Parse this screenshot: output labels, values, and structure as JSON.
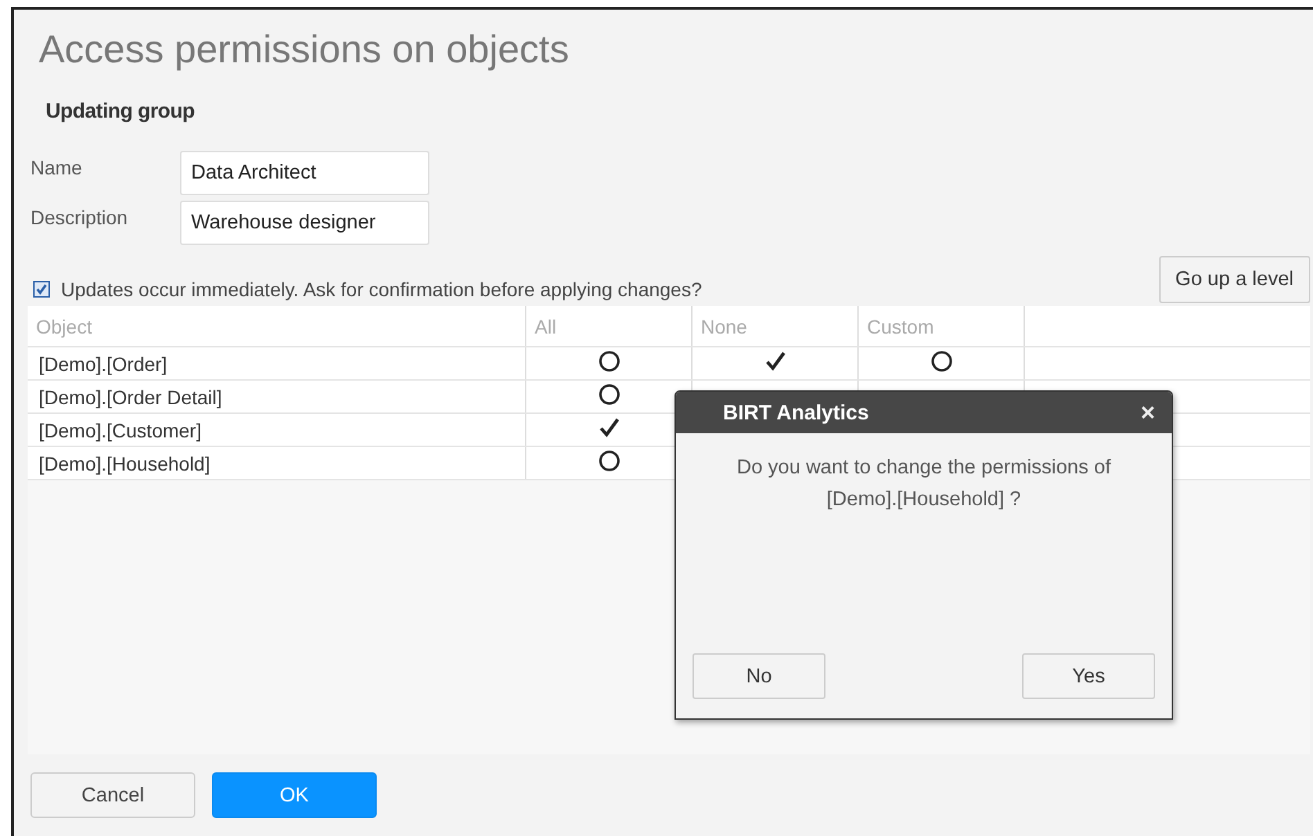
{
  "page": {
    "title": "Access permissions on objects",
    "subtitle": "Updating group"
  },
  "fields": [
    {
      "label": "Name",
      "value": "Data Architect"
    },
    {
      "label": "Description",
      "value": "Warehouse designer"
    }
  ],
  "confirm_option": {
    "label": "Updates occur immediately. Ask for confirmation before applying changes?",
    "checked": true
  },
  "go_up_button": "Go up a level",
  "table": {
    "columns": [
      "Object",
      "All",
      "None",
      "Custom"
    ],
    "rows": [
      {
        "object": "[Demo].[Order]",
        "cells": [
          {
            "checked": false
          },
          {
            "checked": true
          },
          {
            "checked": false
          }
        ]
      },
      {
        "object": "[Demo].[Order Detail]",
        "cells": [
          {
            "checked": false
          }
        ]
      },
      {
        "object": "[Demo].[Customer]",
        "cells": [
          {
            "checked": true
          }
        ]
      },
      {
        "object": "[Demo].[Household]",
        "cells": [
          {
            "checked": false
          }
        ]
      }
    ]
  },
  "buttons": [
    {
      "label": "Cancel",
      "kind": "secondary"
    },
    {
      "label": "OK",
      "kind": "primary"
    }
  ],
  "dialog": {
    "title": "BIRT Analytics",
    "close": "×",
    "message": "Do you want to change the permissions of [Demo].[Household] ?",
    "buttons": [
      "No",
      "Yes"
    ]
  }
}
